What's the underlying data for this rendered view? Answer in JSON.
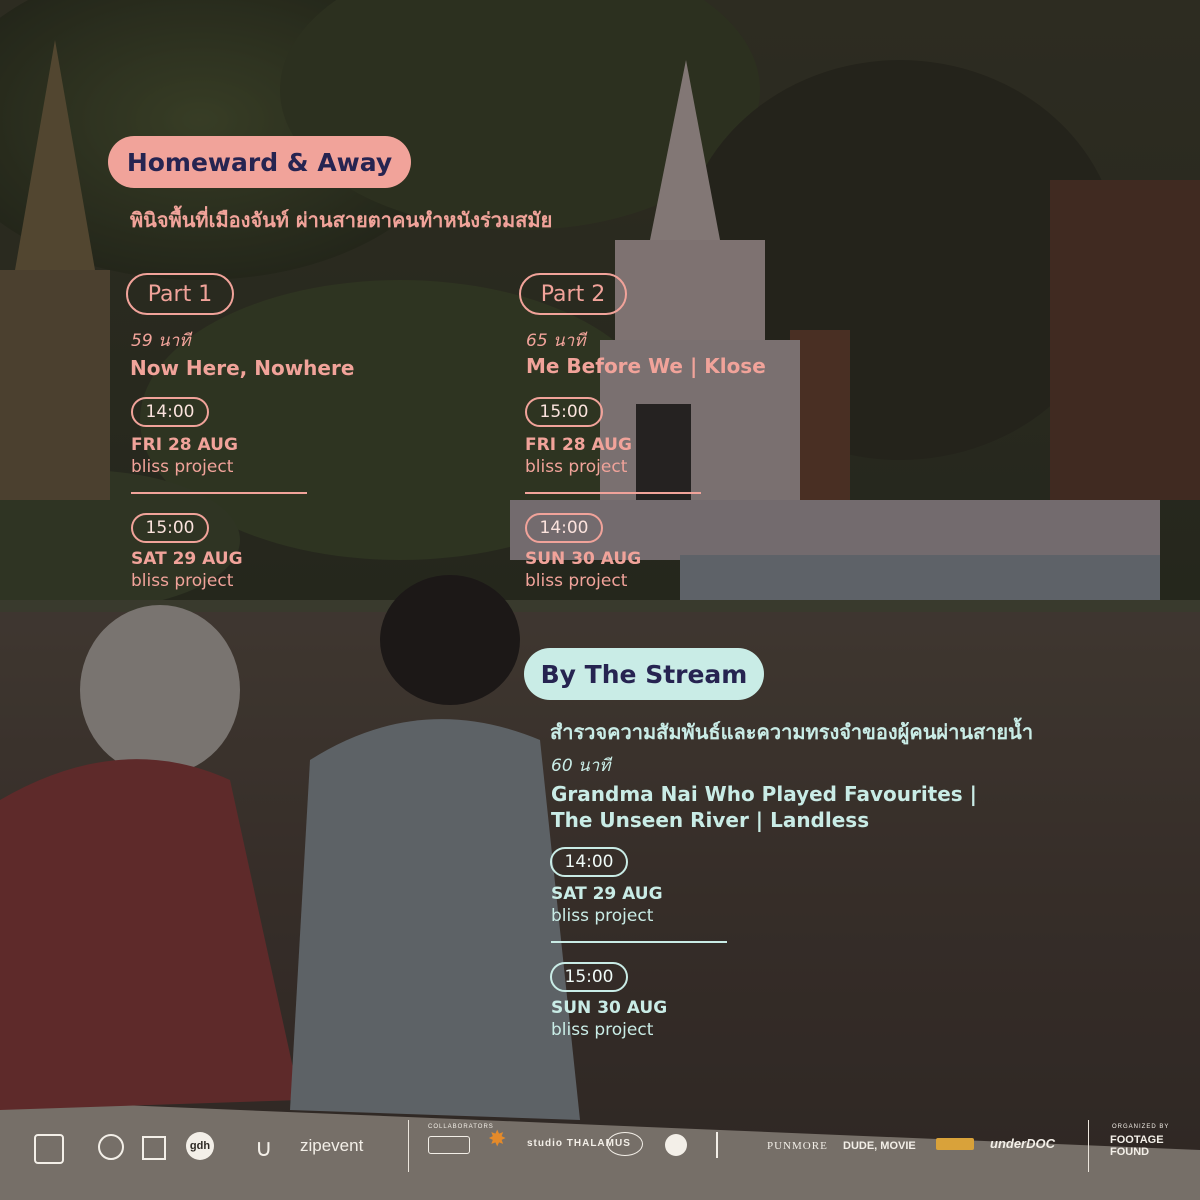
{
  "colors": {
    "pink_accent": "#f1a39a",
    "mint_accent": "#c9ece6",
    "navy_text": "#262451"
  },
  "section1": {
    "title": "Homeward & Away",
    "subtitle": "พินิจพื้นที่เมืองจันท์ ผ่านสายตาคนทำหนังร่วมสมัย",
    "parts": [
      {
        "label": "Part 1",
        "duration": "59 นาที",
        "film": "Now Here, Nowhere",
        "screenings": [
          {
            "time": "14:00",
            "date": "FRI 28 AUG",
            "venue": "bliss project"
          },
          {
            "time": "15:00",
            "date": "SAT 29 AUG",
            "venue": "bliss project"
          }
        ]
      },
      {
        "label": "Part 2",
        "duration": "65 นาที",
        "film": "Me Before We | Klose",
        "screenings": [
          {
            "time": "15:00",
            "date": "FRI 28 AUG",
            "venue": "bliss project"
          },
          {
            "time": "14:00",
            "date": "SUN 30 AUG",
            "venue": "bliss project"
          }
        ]
      }
    ]
  },
  "section2": {
    "title": "By The Stream",
    "subtitle": "สำรวจความสัมพันธ์และความทรงจำของผู้คนผ่านสายน้ำ",
    "duration": "60 นาที",
    "film_line1": "Grandma Nai Who Played Favourites |",
    "film_line2": "The Unseen River | Landless",
    "screenings": [
      {
        "time": "14:00",
        "date": "SAT 29 AUG",
        "venue": "bliss project"
      },
      {
        "time": "15:00",
        "date": "SUN 30 AUG",
        "venue": "bliss project"
      }
    ]
  },
  "logos": {
    "sponsors": [
      "gdh",
      "zipevent"
    ],
    "collaborators_label": "COLLABORATORS",
    "collaborators": [
      "studio THALAMUS",
      "PUNMORE",
      "DUDE, MOVIE",
      "underDOC"
    ],
    "organizer_label": "ORGANIZED BY",
    "organizer": "FOOTAGE FOUND"
  }
}
